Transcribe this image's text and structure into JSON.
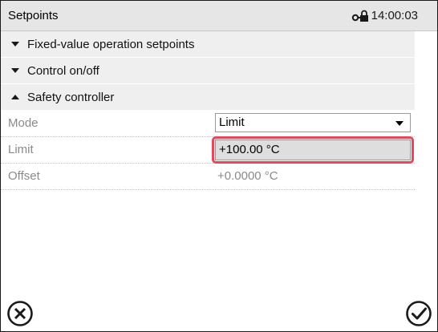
{
  "window": {
    "title": "Setpoints",
    "time": "14:00:03"
  },
  "sections": [
    {
      "label": "Fixed-value operation setpoints",
      "expanded": false
    },
    {
      "label": "Control on/off",
      "expanded": false
    },
    {
      "label": "Safety controller",
      "expanded": true
    }
  ],
  "safety_controller": {
    "mode": {
      "label": "Mode",
      "value": "Limit"
    },
    "limit": {
      "label": "Limit",
      "value": "+100.00 °C"
    },
    "offset": {
      "label": "Offset",
      "value": "+0.0000 °C"
    }
  },
  "icons": {
    "status": "key-lock-icon",
    "cancel": "cancel-circle-icon",
    "confirm": "confirm-check-circle-icon"
  },
  "colors": {
    "highlight": "#e8485a",
    "section_bg": "#efefef",
    "titlebar_bg": "#e6e6e6"
  }
}
